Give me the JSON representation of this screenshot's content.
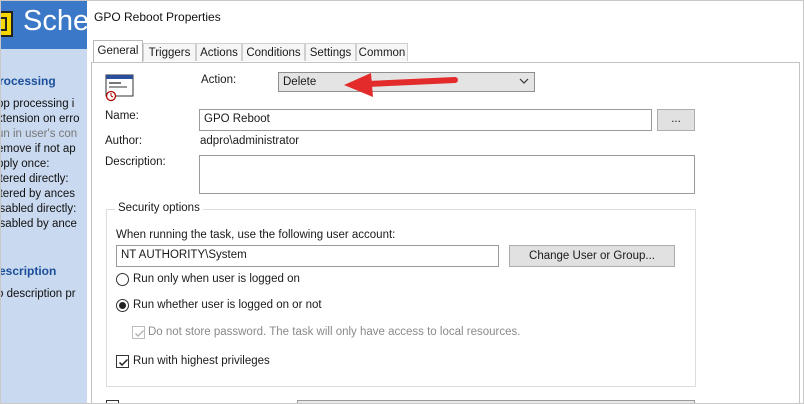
{
  "background_window": {
    "title": "Sche",
    "section_processing": "rocessing",
    "processing_lines": [
      "op processing i",
      "xtension on erro",
      "un in user's con",
      "emove if not ap",
      "pply once:",
      "ltered directly:",
      "ltered by ances",
      "isabled directly:",
      "isabled by ance"
    ],
    "section_description": "escription",
    "description_text": "o description pr"
  },
  "dialog": {
    "title": "GPO Reboot Properties",
    "tabs": [
      {
        "label": "General"
      },
      {
        "label": "Triggers"
      },
      {
        "label": "Actions"
      },
      {
        "label": "Conditions"
      },
      {
        "label": "Settings"
      },
      {
        "label": "Common"
      }
    ],
    "action_label": "Action:",
    "action_value": "Delete",
    "name_label": "Name:",
    "name_value": "GPO Reboot",
    "browse_label": "...",
    "author_label": "Author:",
    "author_value": "adpro\\administrator",
    "description_label": "Description:",
    "description_value": "",
    "security": {
      "title": "Security options",
      "account_prompt": "When running the task, use the following user account:",
      "account_value": "NT AUTHORITY\\System",
      "change_button": "Change User or Group...",
      "radio_logged_on": "Run only when user is logged on",
      "radio_whether": "Run whether user is logged on or not",
      "do_not_store": "Do not store password. The task will only have access to local resources.",
      "highest_privileges": "Run with highest privileges"
    }
  }
}
